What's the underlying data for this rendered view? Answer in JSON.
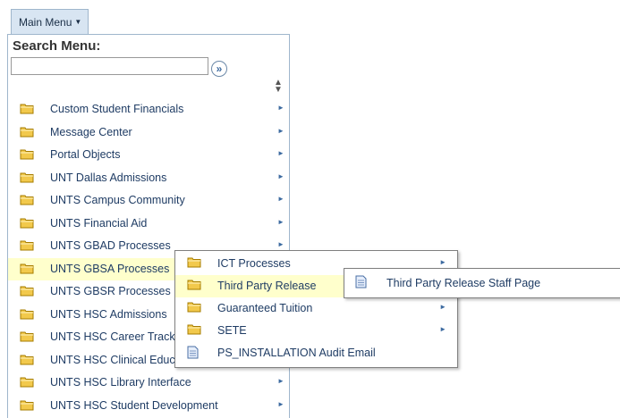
{
  "header": {
    "main_menu_label": "Main Menu",
    "caret": "▼"
  },
  "search": {
    "title": "Search Menu:",
    "value": "",
    "placeholder": "",
    "go_glyph": "»"
  },
  "sort_glyph_up": "▲",
  "sort_glyph_down": "▼",
  "arrow_glyph": "►",
  "menu_items": [
    {
      "label": "Custom Student Financials",
      "icon": "folder-icon",
      "has_submenu": true
    },
    {
      "label": "Message Center",
      "icon": "folder-icon",
      "has_submenu": true
    },
    {
      "label": "Portal Objects",
      "icon": "folder-icon",
      "has_submenu": true
    },
    {
      "label": "UNT Dallas Admissions",
      "icon": "folder-icon",
      "has_submenu": true
    },
    {
      "label": "UNTS Campus Community",
      "icon": "folder-icon",
      "has_submenu": true
    },
    {
      "label": "UNTS Financial Aid",
      "icon": "folder-icon",
      "has_submenu": true
    },
    {
      "label": "UNTS GBAD Processes",
      "icon": "folder-icon",
      "has_submenu": true
    },
    {
      "label": "UNTS GBSA Processes",
      "icon": "folder-icon",
      "has_submenu": true,
      "active": true
    },
    {
      "label": "UNTS GBSR Processes",
      "icon": "folder-icon",
      "has_submenu": true
    },
    {
      "label": "UNTS HSC Admissions",
      "icon": "folder-icon",
      "has_submenu": true
    },
    {
      "label": "UNTS HSC Career Track",
      "icon": "folder-icon",
      "has_submenu": true
    },
    {
      "label": "UNTS HSC Clinical Education",
      "icon": "folder-icon",
      "has_submenu": true
    },
    {
      "label": "UNTS HSC Library Interface",
      "icon": "folder-icon",
      "has_submenu": true
    },
    {
      "label": "UNTS HSC Student Development",
      "icon": "folder-icon",
      "has_submenu": true
    }
  ],
  "submenu_gbsa": [
    {
      "label": "ICT Processes",
      "icon": "folder-icon",
      "has_submenu": true
    },
    {
      "label": "Third Party Release",
      "icon": "folder-icon",
      "has_submenu": true,
      "active": true
    },
    {
      "label": "Guaranteed Tuition",
      "icon": "folder-icon",
      "has_submenu": true
    },
    {
      "label": "SETE",
      "icon": "folder-icon",
      "has_submenu": true
    },
    {
      "label": "PS_INSTALLATION Audit Email",
      "icon": "document-icon",
      "has_submenu": false
    }
  ],
  "submenu_third_party": [
    {
      "label": "Third Party Release Staff Page",
      "icon": "document-icon",
      "has_submenu": false
    }
  ],
  "colors": {
    "accent": "#1f3c64",
    "hover": "#ffffcc",
    "folder": "#f2c94c",
    "header_bg": "#d8e5f2"
  }
}
